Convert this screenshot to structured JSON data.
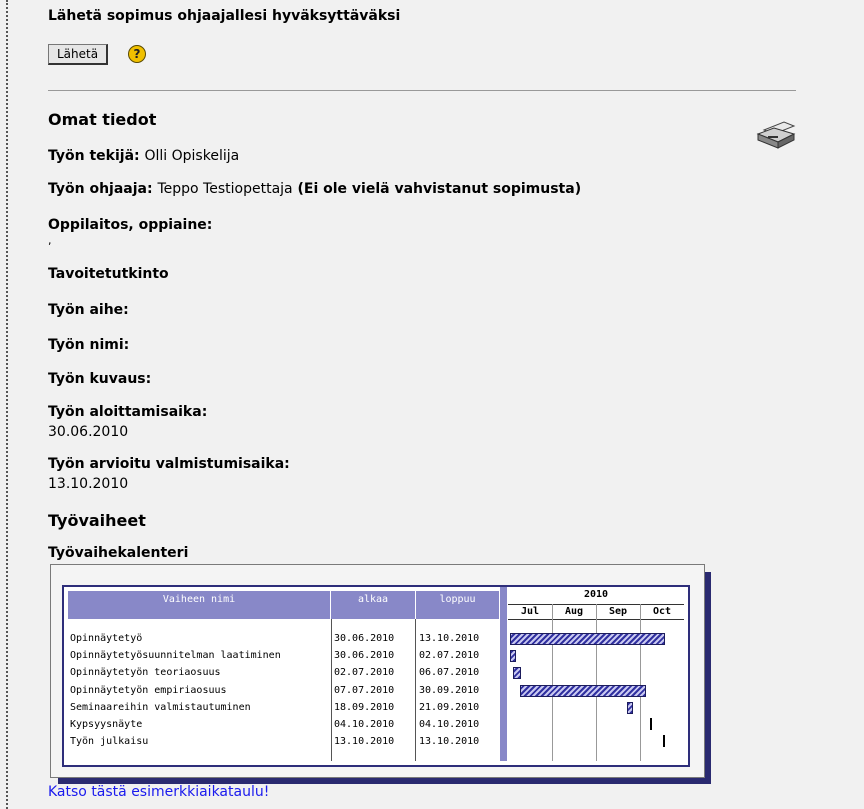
{
  "submit": {
    "heading": "Lähetä sopimus ohjaajallesi hyväksyttäväksi",
    "button_label": "Lähetä",
    "help_glyph": "?"
  },
  "own_info": {
    "title": "Omat tiedot",
    "author_label": "Työn tekijä:",
    "author_value": "Olli Opiskelija",
    "supervisor_label": "Työn ohjaaja:",
    "supervisor_value": "Teppo Testiopettaja",
    "supervisor_note": "(Ei ole vielä vahvistanut sopimusta)",
    "school_label": "Oppilaitos, oppiaine:",
    "school_value": ",",
    "degree_label": "Tavoitetutkinto",
    "topic_label": "Työn aihe:",
    "name_label": "Työn nimi:",
    "description_label": "Työn kuvaus:",
    "start_label": "Työn aloittamisaika:",
    "start_value": "30.06.2010",
    "end_label": "Työn arvioitu valmistumisaika:",
    "end_value": "13.10.2010"
  },
  "phases": {
    "title": "Työvaiheet",
    "calendar_title": "Työvaihekalenteri",
    "headers": {
      "name": "Vaiheen nimi",
      "start": "alkaa",
      "end": "loppuu",
      "year": "2010"
    },
    "months": [
      "Jul",
      "Aug",
      "Sep",
      "Oct"
    ],
    "rows": [
      {
        "name": "Opinnäytetyö",
        "start": "30.06.2010",
        "end": "13.10.2010",
        "s": 0,
        "e": 105
      },
      {
        "name": "Opinnäytetyösuunnitelman laatiminen",
        "start": "30.06.2010",
        "end": "02.07.2010",
        "s": 0,
        "e": 2
      },
      {
        "name": "Opinnäytetyön teoriaosuus",
        "start": "02.07.2010",
        "end": "06.07.2010",
        "s": 2,
        "e": 6
      },
      {
        "name": "Opinnäytetyön empiriaosuus",
        "start": "07.07.2010",
        "end": "30.09.2010",
        "s": 7,
        "e": 92
      },
      {
        "name": "Seminaareihin valmistautuminen",
        "start": "18.09.2010",
        "end": "21.09.2010",
        "s": 80,
        "e": 83
      },
      {
        "name": "Kypsyysnäyte",
        "start": "04.10.2010",
        "end": "04.10.2010",
        "s": 96,
        "e": 96
      },
      {
        "name": "Työn julkaisu",
        "start": "13.10.2010",
        "end": "13.10.2010",
        "s": 105,
        "e": 105
      }
    ],
    "link_text": "Katso tästä esimerkkiaikataulu!"
  },
  "icons": {
    "printer": "printer-icon",
    "help": "help-icon"
  }
}
